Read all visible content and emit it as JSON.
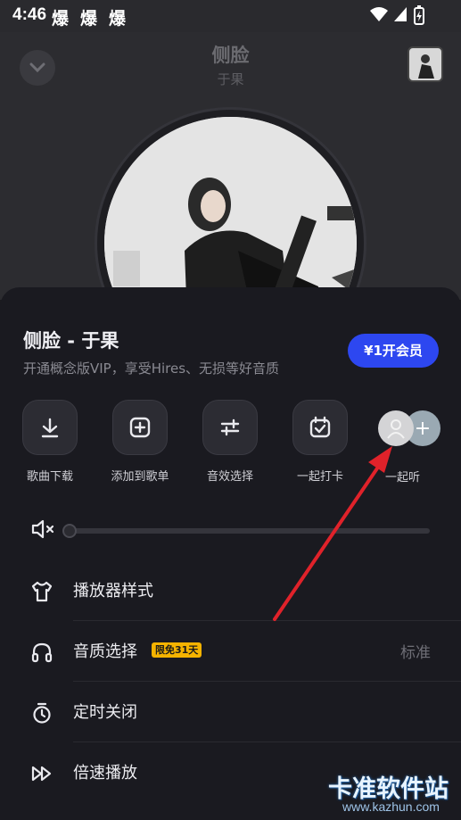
{
  "status_bar": {
    "time": "4:46",
    "notifications": [
      "爆",
      "爆",
      "爆"
    ]
  },
  "player": {
    "song_title": "侧脸",
    "artist": "于果"
  },
  "sheet": {
    "title": "侧脸 - 于果",
    "subtitle": "开通概念版VIP，享受Hires、无损等好音质",
    "vip_button": "¥1开会员",
    "actions": [
      {
        "label": "歌曲下载",
        "icon": "download-icon"
      },
      {
        "label": "添加到歌单",
        "icon": "add-playlist-icon"
      },
      {
        "label": "音效选择",
        "icon": "equalizer-icon"
      },
      {
        "label": "一起打卡",
        "icon": "checkin-icon"
      }
    ],
    "listen_together_label": "一起听",
    "volume_fraction": 0.0,
    "menu": [
      {
        "label": "播放器样式",
        "icon": "shirt-icon"
      },
      {
        "label": "音质选择",
        "icon": "headphones-icon",
        "badge": "限免31天",
        "value": "标准"
      },
      {
        "label": "定时关闭",
        "icon": "timer-icon"
      },
      {
        "label": "倍速播放",
        "icon": "speed-icon"
      }
    ]
  },
  "watermark": {
    "text": "卡准软件站",
    "url": "www.kazhun.com"
  },
  "colors": {
    "accent": "#2d47f0",
    "badge": "#f5b300",
    "arrow": "#e0222a"
  }
}
